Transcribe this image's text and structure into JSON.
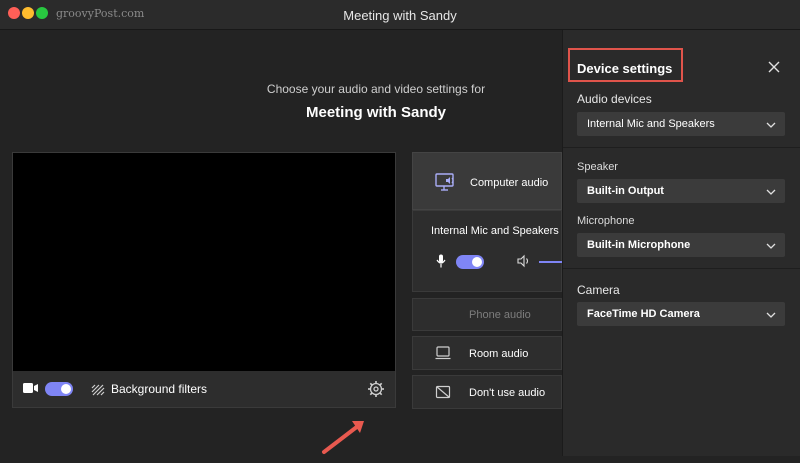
{
  "window": {
    "title": "Meeting with Sandy",
    "watermark": "groovyPost.com"
  },
  "main": {
    "subtitle": "Choose your audio and video settings for",
    "meeting_title": "Meeting with Sandy",
    "preview_bar": {
      "background_filters_label": "Background filters"
    }
  },
  "audio_options": {
    "computer_audio": "Computer audio",
    "internal_device": "Internal Mic and Speakers",
    "phone_audio": "Phone audio",
    "room_audio": "Room audio",
    "dont_use_audio": "Don't use audio"
  },
  "device_settings": {
    "title": "Device settings",
    "audio_devices_label": "Audio devices",
    "audio_devices_value": "Internal Mic and Speakers",
    "speaker_label": "Speaker",
    "speaker_value": "Built-in Output",
    "microphone_label": "Microphone",
    "microphone_value": "Built-in Microphone",
    "camera_label": "Camera",
    "camera_value": "FaceTime HD Camera"
  },
  "colors": {
    "accent": "#7f85f5",
    "highlight": "#e0544b",
    "background": "#232323"
  }
}
